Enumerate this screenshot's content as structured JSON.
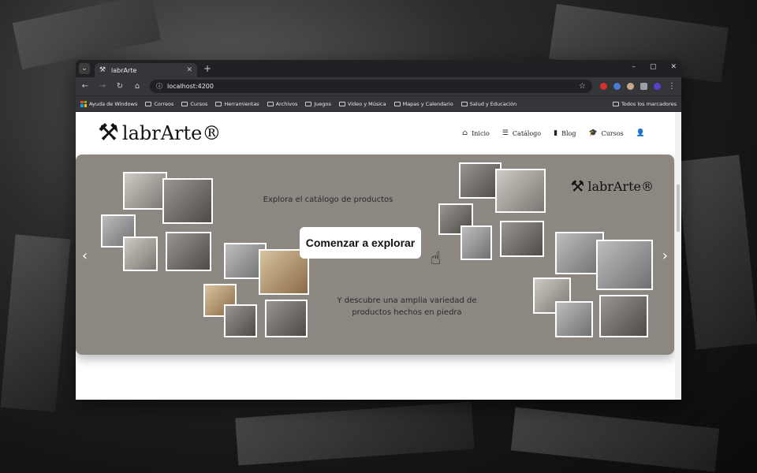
{
  "browser": {
    "tab_title": "labrArte",
    "new_tab_label": "+",
    "url": "localhost:4200",
    "window_controls": [
      "–",
      "▢",
      "✕"
    ]
  },
  "bookmarks": [
    {
      "label": "Ayuda de Windows",
      "icon": "windows-logo"
    },
    {
      "label": "Correos",
      "icon": "folder"
    },
    {
      "label": "Cursos",
      "icon": "folder"
    },
    {
      "label": "Herramientas",
      "icon": "folder"
    },
    {
      "label": "Archivos",
      "icon": "folder"
    },
    {
      "label": "Juegos",
      "icon": "folder"
    },
    {
      "label": "Video y Música",
      "icon": "folder"
    },
    {
      "label": "Mapas y Calendario",
      "icon": "folder"
    },
    {
      "label": "Salud y Educación",
      "icon": "folder"
    }
  ],
  "bookmarks_right": "Todos los marcadores",
  "site": {
    "logo_text": "labrArte®",
    "nav": [
      {
        "label": "Inicio",
        "icon": "home-icon",
        "glyph": "⌂"
      },
      {
        "label": "Catálogo",
        "icon": "list-icon",
        "glyph": "☰"
      },
      {
        "label": "Blog",
        "icon": "book-icon",
        "glyph": "▮"
      },
      {
        "label": "Cursos",
        "icon": "graduation-cap-icon",
        "glyph": "🎓"
      }
    ],
    "user_icon": "user-icon"
  },
  "hero": {
    "caption_top": "Explora el catálogo de productos",
    "cta_label": "Comenzar a explorar",
    "caption_bottom_1": "Y descubre una amplia variedad de",
    "caption_bottom_2": "productos hechos en piedra",
    "mini_logo_text": "labrArte®"
  },
  "colors": {
    "carousel_bg": "#8c8781",
    "browser_dark": "#202124"
  }
}
